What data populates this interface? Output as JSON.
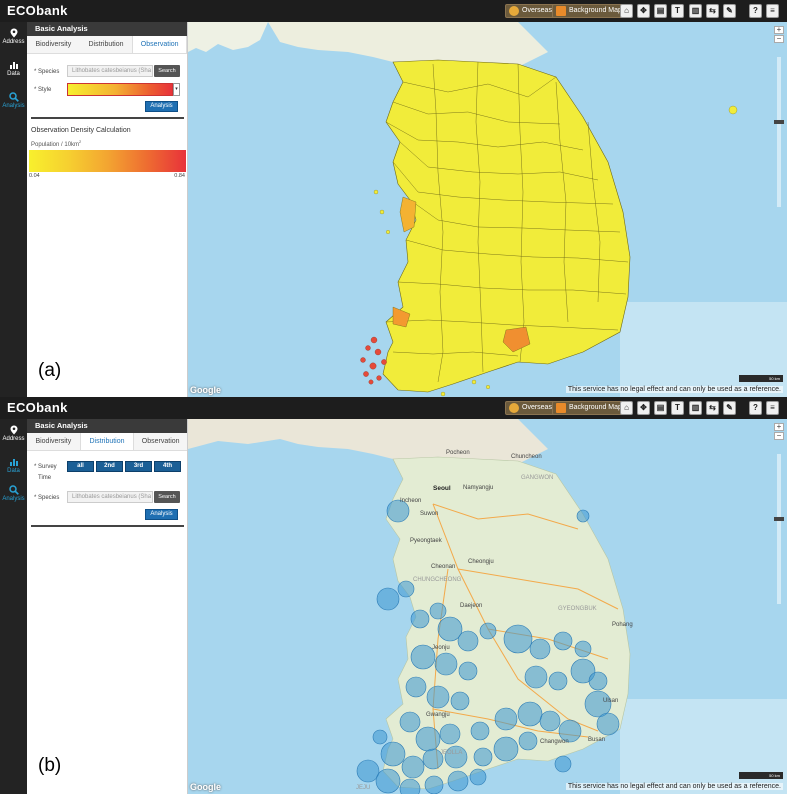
{
  "app": {
    "logo": "ECObank"
  },
  "topbar": {
    "overseas": "Overseas",
    "background_map": "Background Map",
    "tools": [
      "⌂",
      "✥",
      "▤",
      "T",
      "▥",
      "⇆",
      "✎",
      "?",
      "≡"
    ]
  },
  "rail": {
    "address": "Address",
    "data": "Data",
    "analysis": "Analysis"
  },
  "panel_header": "Basic Analysis",
  "tabs": [
    "Biodiversity",
    "Distribution",
    "Observation"
  ],
  "colors": {
    "accent": "#1f73b7",
    "density_low": "#f7ef2e",
    "density_high": "#e8323a",
    "land": "#f1ec3a",
    "sea": "#a7d6ee",
    "bubble": "#3d97d2"
  },
  "panel_a": {
    "label": "(a)",
    "active_tab": "Observation",
    "species_label": "* Species",
    "species_value": "Lithobates catesbeianus (Sha",
    "search": "Search",
    "style_label": "* Style",
    "analysis": "Analysis",
    "legend_title": "Observation Density Calculation",
    "legend_unit_prefix": "Population / 10km",
    "legend_unit_sup": "2",
    "legend_min": "0.04",
    "legend_max": "0.84"
  },
  "panel_b": {
    "label": "(b)",
    "active_tab": "Distribution",
    "survey_label_1": "* Survey",
    "survey_label_2": "Time",
    "survey_buttons": [
      "all",
      "2nd",
      "3rd",
      "4th"
    ],
    "species_label": "* Species",
    "species_value": "Lithobates catesbeianus (Sha",
    "search": "Search",
    "analysis": "Analysis",
    "map_labels": [
      "Pocheon",
      "Chuncheon",
      "GANGWON",
      "Seoul",
      "Incheon",
      "Namyangju",
      "Suwon",
      "Pyeongtaek",
      "Cheonan",
      "Cheongju",
      "CHUNGCHEONG",
      "Daejeon",
      "GYEONGBUK",
      "Pohang",
      "Jeonju",
      "Gwangju",
      "JEOLLA",
      "Ulsan",
      "Busan",
      "JEJU",
      "Changwon"
    ]
  },
  "map_common": {
    "google": "Google",
    "disclaimer": "This service has no legal effect and can only be used as a reference.",
    "scale": "50 km",
    "zoom_in": "+",
    "zoom_out": "−"
  }
}
